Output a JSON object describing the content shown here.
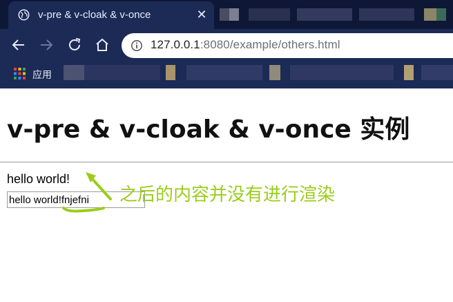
{
  "browser": {
    "tab": {
      "title": "v-pre & v-cloak & v-once",
      "close_glyph": "✕",
      "favicon": "globe-icon"
    },
    "address_bar": {
      "url_host": "127.0.0.1",
      "url_rest": ":8080/example/others.html",
      "info_icon": "info-icon"
    },
    "nav": {
      "back_icon": "back-arrow-icon",
      "forward_icon": "forward-arrow-icon",
      "reload_icon": "reload-icon",
      "home_icon": "home-icon"
    },
    "bookmarks": {
      "apps_label": "应用",
      "apps_icon": "apps-grid-icon"
    },
    "colors": {
      "frame": "#0f1736",
      "toolbar": "#1c2a56"
    }
  },
  "page": {
    "heading": "v-pre & v-cloak & v-once 实例",
    "hello_text": "hello world!",
    "input_value": "hello world!fnjefni"
  },
  "annotation": {
    "text": "之后的内容并没有进行渲染",
    "color": "#9acd1b"
  }
}
